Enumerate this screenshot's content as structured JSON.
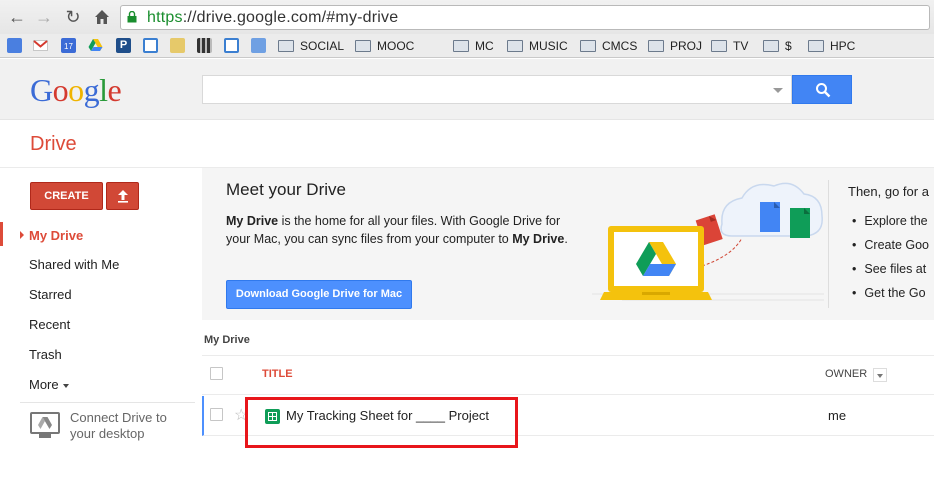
{
  "browser": {
    "url_scheme": "https",
    "url_rest": "://drive.google.com/#my-drive",
    "nav": [
      "back-icon",
      "forward-icon",
      "reload-icon",
      "home-icon"
    ],
    "bookmark_folders": [
      "SOCIAL",
      "MOOC",
      "MC",
      "MUSIC",
      "CMCS",
      "PROJ",
      "TV",
      "$",
      "HPC"
    ],
    "bookmark_icons": [
      "google-docs-icon",
      "gmail-icon",
      "calendar-icon",
      "drive-icon",
      "pandora-icon",
      "window-icon",
      "beer-icon",
      "tiles-icon",
      "window-icon",
      "bookmark-icon"
    ]
  },
  "header": {
    "logo_letters": [
      {
        "ch": "G",
        "color": "#3b6bd6"
      },
      {
        "ch": "o",
        "color": "#d43a2f"
      },
      {
        "ch": "o",
        "color": "#f0b400"
      },
      {
        "ch": "g",
        "color": "#3b6bd6"
      },
      {
        "ch": "l",
        "color": "#2a9a3a"
      },
      {
        "ch": "e",
        "color": "#d43a2f"
      }
    ],
    "search_value": "",
    "product_title": "Drive"
  },
  "sidebar": {
    "create_label": "CREATE",
    "items": [
      {
        "label": "My Drive",
        "active": true
      },
      {
        "label": "Shared with Me",
        "active": false
      },
      {
        "label": "Starred",
        "active": false
      },
      {
        "label": "Recent",
        "active": false
      },
      {
        "label": "Trash",
        "active": false
      },
      {
        "label": "More",
        "active": false
      }
    ],
    "connect_line1": "Connect Drive to",
    "connect_line2": "your desktop"
  },
  "promo": {
    "title": "Meet your Drive",
    "text_bold1": "My Drive",
    "text_mid": " is the home for all your files. With Google Drive for your Mac, you can sync files from your computer to ",
    "text_bold2": "My Drive",
    "text_end": ".",
    "download_label": "Download Google Drive for Mac",
    "right_title": "Then, go for a",
    "right_bullets": [
      "Explore the",
      "Create Goo",
      "See files at",
      "Get the Go"
    ]
  },
  "list": {
    "heading": "My Drive",
    "col_title": "TITLE",
    "col_owner": "OWNER",
    "files": [
      {
        "name": "My Tracking Sheet for ____ Project",
        "owner": "me",
        "type": "spreadsheet"
      }
    ]
  },
  "colors": {
    "accent_red": "#dd4b39",
    "create_red": "#d14836",
    "link_blue": "#4d90fe",
    "highlight": "#e8161b"
  }
}
